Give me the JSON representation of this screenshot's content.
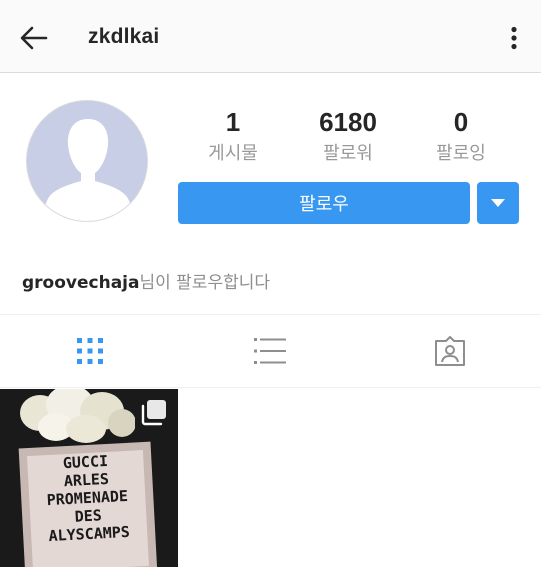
{
  "header": {
    "username": "zkdlkai",
    "back_icon": "arrow-left-icon",
    "more_icon": "vertical-ellipsis-icon"
  },
  "profile": {
    "avatar_icon": "default-user-silhouette-icon",
    "stats": [
      {
        "value": "1",
        "label": "게시물"
      },
      {
        "value": "6180",
        "label": "팔로워"
      },
      {
        "value": "0",
        "label": "팔로잉"
      }
    ],
    "follow_label": "팔로우",
    "dropdown_icon": "caret-down-icon",
    "followed_by_user": "groovechaja",
    "followed_by_suffix": "님이 팔로우합니다"
  },
  "tabs": [
    {
      "name": "grid",
      "icon": "grid-icon",
      "active": true
    },
    {
      "name": "list",
      "icon": "list-icon",
      "active": false
    },
    {
      "name": "tagged",
      "icon": "tagged-person-icon",
      "active": false
    }
  ],
  "posts": [
    {
      "image_text": [
        "GUCCI",
        "ARLES",
        "PROMENADE",
        "DES",
        "ALYSCAMPS"
      ],
      "badge_icon": "multiple-photos-icon"
    }
  ],
  "colors": {
    "accent": "#3897f0",
    "text_primary": "#262626",
    "text_secondary": "#999999",
    "topbar_bg": "#fafafa",
    "divider": "#dbdbdb"
  }
}
